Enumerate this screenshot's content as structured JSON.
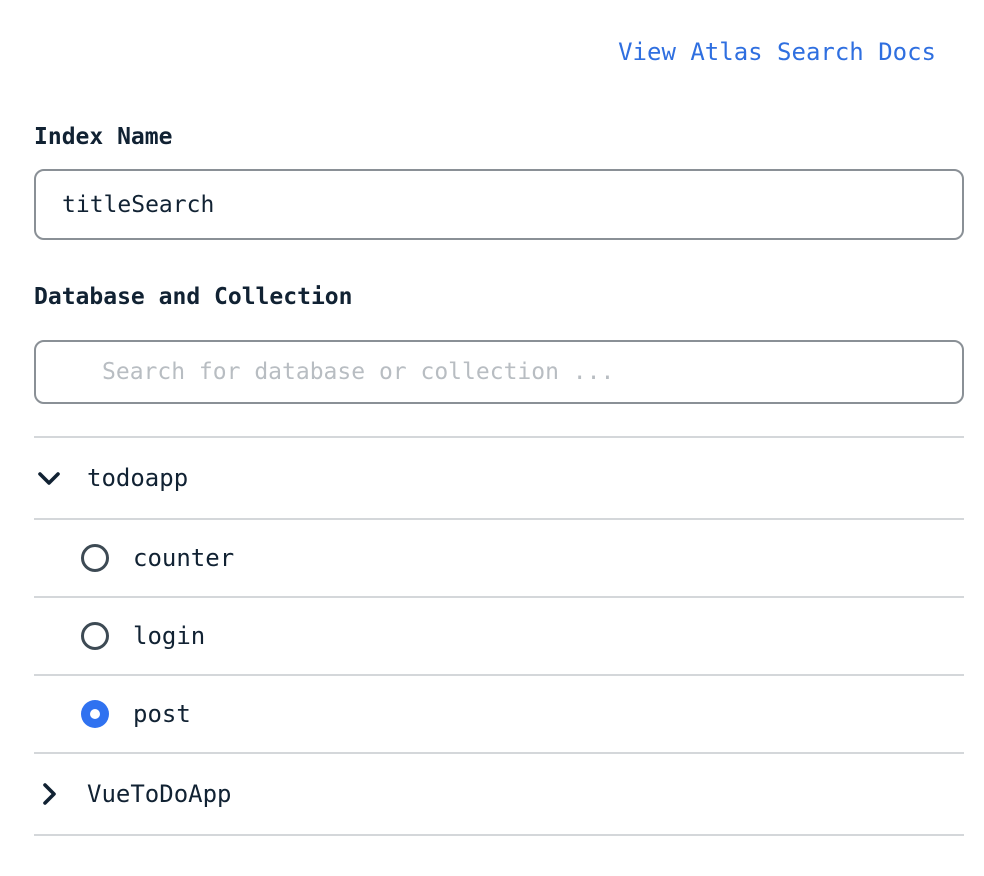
{
  "header": {
    "docs_link": "View Atlas Search Docs"
  },
  "index_name": {
    "label": "Index Name",
    "value": "titleSearch"
  },
  "database_collection": {
    "label": "Database and Collection",
    "search_placeholder": "Search for database or collection ..."
  },
  "tree": {
    "databases": [
      {
        "name": "todoapp",
        "expanded": true,
        "icon": "chevron-down-icon",
        "collections": [
          {
            "name": "counter",
            "selected": false
          },
          {
            "name": "login",
            "selected": false
          },
          {
            "name": "post",
            "selected": true
          }
        ]
      },
      {
        "name": "VueToDoApp",
        "expanded": false,
        "icon": "chevron-right-icon"
      }
    ]
  },
  "colors": {
    "link": "#2f6fe0",
    "radio_selected": "#3072f0",
    "text": "#112233",
    "border": "#8a9096",
    "divider": "#d4d7da"
  }
}
